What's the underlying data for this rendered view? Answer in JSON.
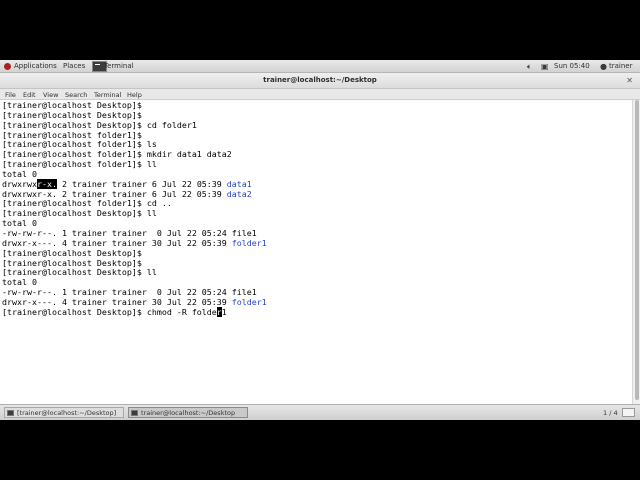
{
  "top_panel": {
    "applications": "Applications",
    "places": "Places",
    "terminal_task": "Terminal",
    "clock": "Sun 05:40",
    "user": "trainer",
    "icons": [
      "fedora-logo-icon",
      "terminal-icon",
      "volume-icon",
      "network-icon",
      "user-icon"
    ]
  },
  "window": {
    "title": "trainer@localhost:~/Desktop",
    "close_glyph": "✕"
  },
  "menu": [
    "File",
    "Edit",
    "View",
    "Search",
    "Terminal",
    "Help"
  ],
  "terminal": {
    "colors": {
      "dir": "#2443c7",
      "text": "#000000",
      "background": "#ffffff"
    },
    "lines": [
      "[trainer@localhost Desktop]$",
      "[trainer@localhost Desktop]$",
      "[trainer@localhost Desktop]$ cd folder1",
      "[trainer@localhost folder1]$",
      "[trainer@localhost folder1]$ ls",
      "[trainer@localhost folder1]$ mkdir data1 data2",
      "[trainer@localhost folder1]$ ll",
      "total 0",
      {
        "pre": "drwxrwx",
        "hl": "r-x.",
        "post": " 2 trainer trainer 6 Jul 22 05:39 ",
        "dir": "data1"
      },
      {
        "pre": "drwxrwxr-x. 2 trainer trainer 6 Jul 22 05:39 ",
        "dir": "data2"
      },
      "[trainer@localhost folder1]$ cd ..",
      "[trainer@localhost Desktop]$ ll",
      "total 0",
      "-rw-rw-r--. 1 trainer trainer  0 Jul 22 05:24 file1",
      {
        "pre": "drwxr-x---. 4 trainer trainer 30 Jul 22 05:39 ",
        "dir": "folder1"
      },
      "[trainer@localhost Desktop]$",
      "[trainer@localhost Desktop]$",
      "[trainer@localhost Desktop]$ ll",
      "total 0",
      "-rw-rw-r--. 1 trainer trainer  0 Jul 22 05:24 file1",
      {
        "pre": "drwxr-x---. 4 trainer trainer 30 Jul 22 05:39 ",
        "dir": "folder1"
      },
      {
        "pre": "[trainer@localhost Desktop]$ chmod -R folde",
        "cursor": "r",
        "post": "1"
      }
    ]
  },
  "bottom_panel": {
    "tasks": [
      "[trainer@localhost:~/Desktop]",
      "trainer@localhost:~/Desktop"
    ],
    "workspace": "1 / 4"
  }
}
